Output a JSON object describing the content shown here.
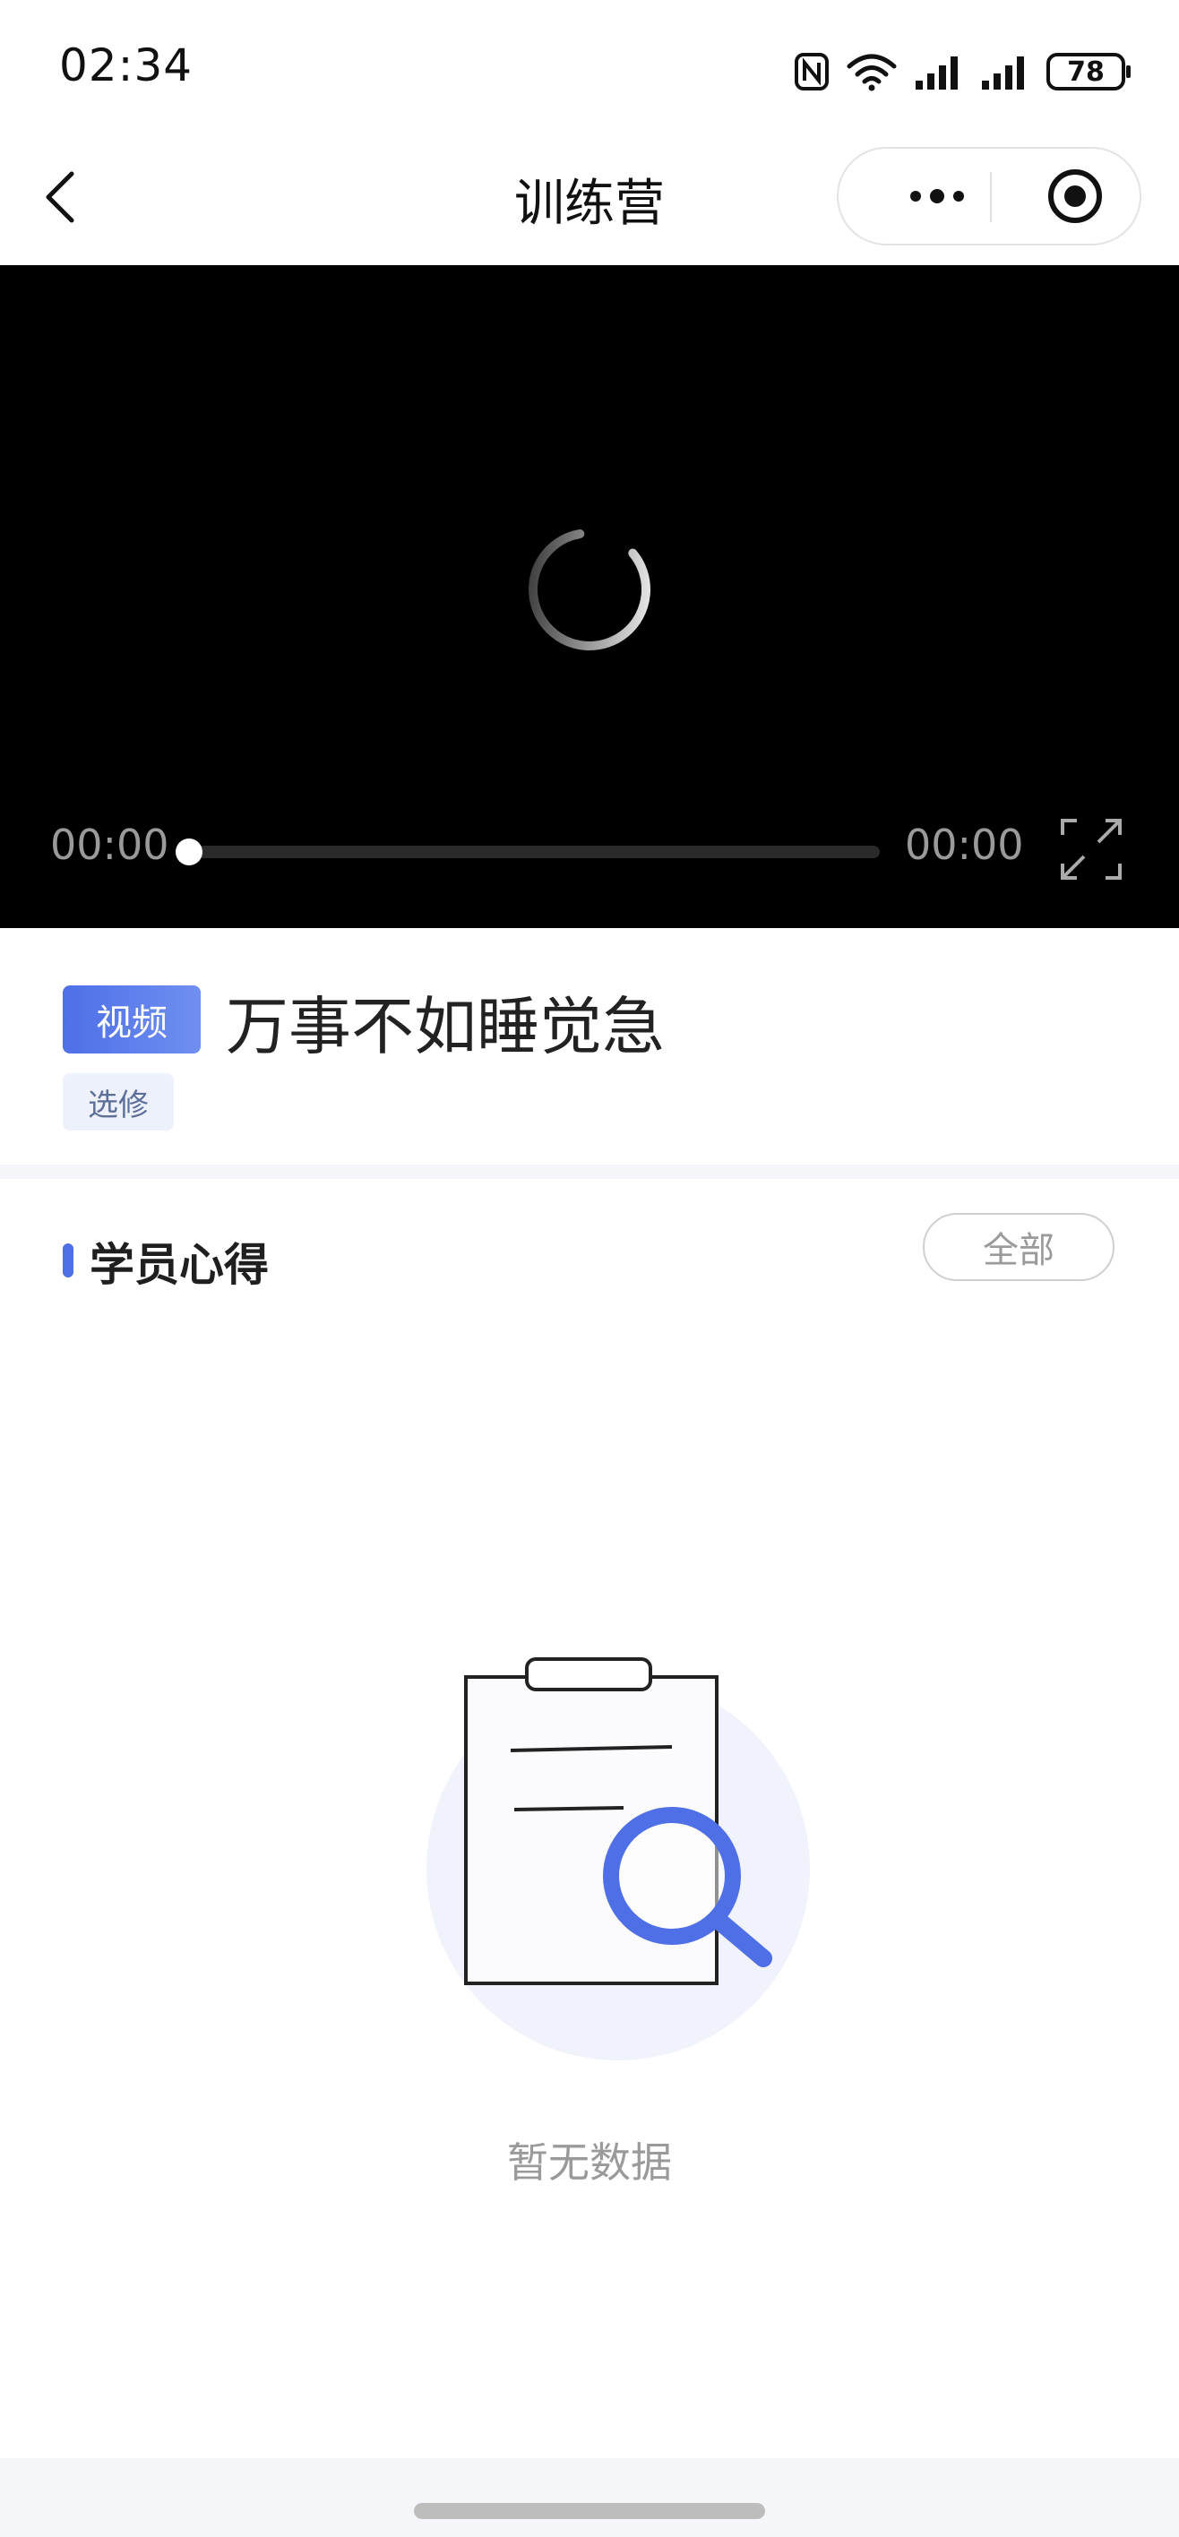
{
  "status_bar": {
    "time": "02:34",
    "battery": "78"
  },
  "nav": {
    "title": "训练营"
  },
  "video": {
    "current_time": "00:00",
    "duration": "00:00",
    "progress": 0
  },
  "lesson": {
    "type_tag": "视频",
    "title": "万事不如睡觉急",
    "elective_tag": "选修"
  },
  "section": {
    "title": "学员心得",
    "all_button": "全部",
    "empty_text": "暂无数据"
  },
  "colors": {
    "accent": "#4e6fe6",
    "tag_bg": "#edf1fb",
    "muted": "#9a9a9a"
  },
  "icons": [
    "nfc-icon",
    "wifi-icon",
    "signal-icon",
    "battery-icon",
    "back-icon",
    "more-icon",
    "target-icon",
    "loading-spinner-icon",
    "fullscreen-icon",
    "empty-clipboard-search-icon"
  ]
}
